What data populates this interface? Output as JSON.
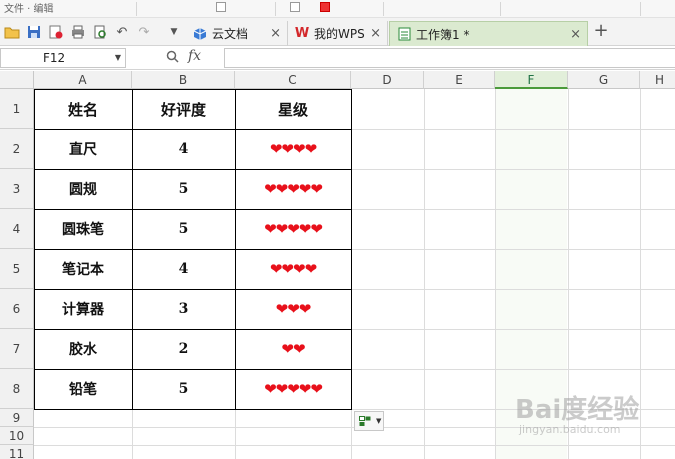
{
  "ribbon": {
    "fragment_label": "文件 · 编辑"
  },
  "tabs": [
    {
      "label": "云文档",
      "close": "×"
    },
    {
      "label": "我的WPS",
      "close": "×"
    },
    {
      "label": "工作簿1 *",
      "close": "×"
    }
  ],
  "new_tab": "+",
  "formula_bar": {
    "name_box": "F12",
    "fx": "fx",
    "formula": ""
  },
  "columns": [
    "A",
    "B",
    "C",
    "D",
    "E",
    "F",
    "G",
    "H"
  ],
  "rows": [
    "1",
    "2",
    "3",
    "4",
    "5",
    "6",
    "7",
    "8",
    "9",
    "10",
    "11"
  ],
  "table": {
    "headers": [
      "姓名",
      "好评度",
      "星级"
    ],
    "rows": [
      {
        "name": "直尺",
        "rating": "4",
        "stars": "❤❤❤❤"
      },
      {
        "name": "圆规",
        "rating": "5",
        "stars": "❤❤❤❤❤"
      },
      {
        "name": "圆珠笔",
        "rating": "5",
        "stars": "❤❤❤❤❤"
      },
      {
        "name": "笔记本",
        "rating": "4",
        "stars": "❤❤❤❤"
      },
      {
        "name": "计算器",
        "rating": "3",
        "stars": "❤❤❤"
      },
      {
        "name": "胶水",
        "rating": "2",
        "stars": "❤❤"
      },
      {
        "name": "铅笔",
        "rating": "5",
        "stars": "❤❤❤❤❤"
      }
    ]
  },
  "watermark": {
    "main": "Bai度经验",
    "sub": "jingyan.baidu.com"
  },
  "colors": {
    "heart": "#e8101a",
    "active_tab": "#dbead0",
    "selected_col_header": "#e2efda"
  }
}
